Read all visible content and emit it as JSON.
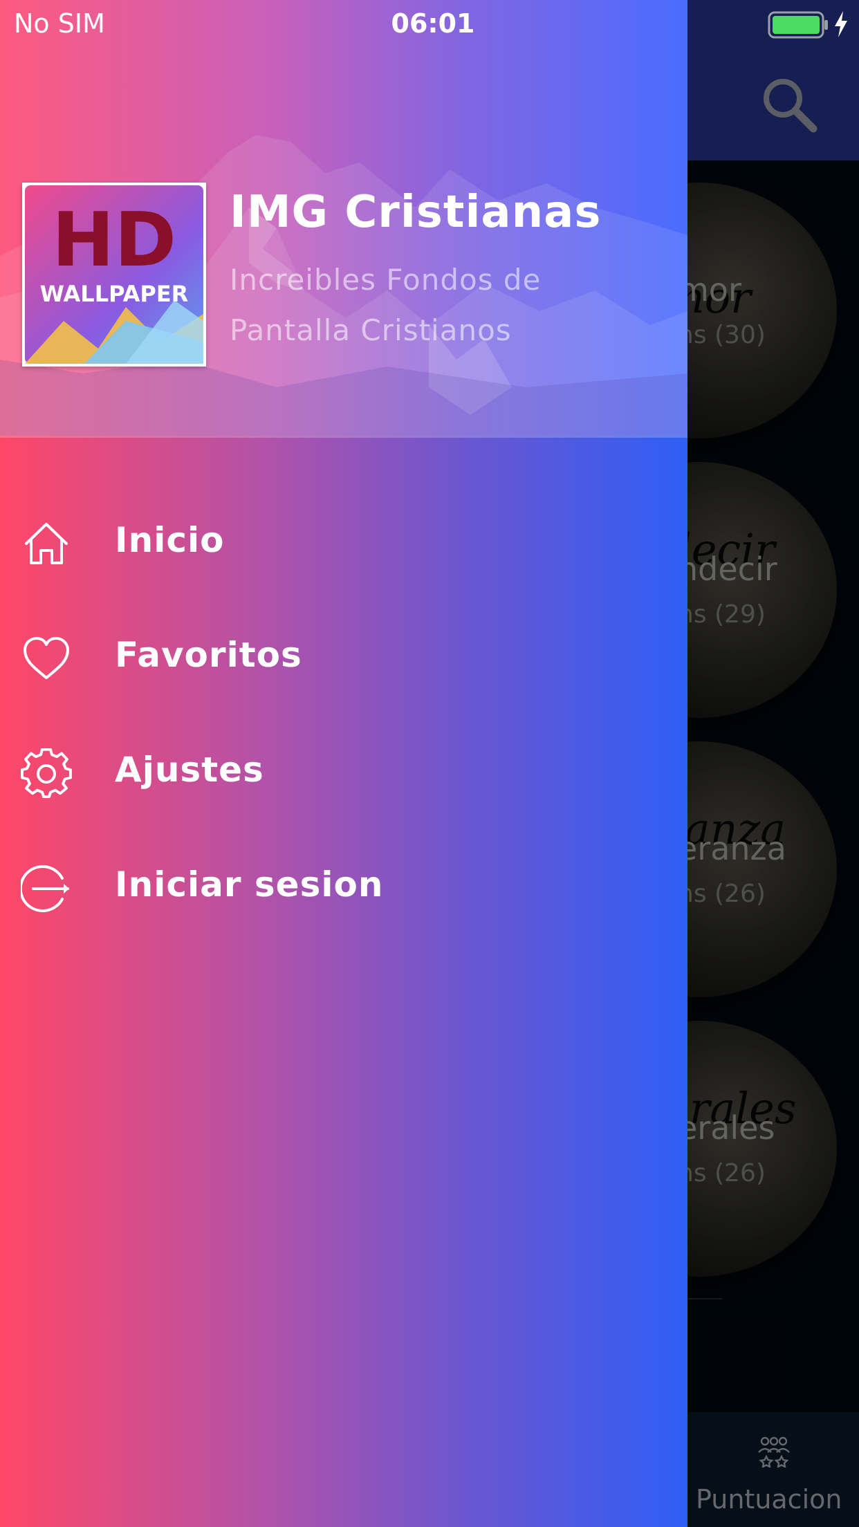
{
  "status_bar": {
    "carrier": "No SIM",
    "time": "06:01",
    "battery_icon": "battery-full-icon",
    "charging_icon": "lightning-bolt-icon"
  },
  "background_app": {
    "header": {
      "search_icon": "search-icon",
      "color": "#2b3a95"
    },
    "categories": [
      {
        "title_partial": "mor",
        "ghost_text": "mor",
        "count_partial": "ns (30)"
      },
      {
        "title_partial": "ndecir",
        "ghost_text": "decir",
        "count_partial": "ns (29)"
      },
      {
        "title_partial": "eranza",
        "ghost_text": "ranza",
        "count_partial": "ns (26)"
      },
      {
        "title_partial": "erales",
        "ghost_text": "erales",
        "count_partial": "ns (26)"
      }
    ],
    "bottom_nav": {
      "rating_label": "Puntuacion",
      "rating_icon": "group-rating-icon"
    }
  },
  "drawer": {
    "header": {
      "logo": {
        "line1": "HD",
        "line2": "WALLPAPER"
      },
      "title": "IMG Cristianas",
      "subtitle": "Increibles Fondos de Pantalla Cristianos"
    },
    "menu": [
      {
        "label": "Inicio",
        "icon": "home-icon"
      },
      {
        "label": "Favoritos",
        "icon": "heart-icon"
      },
      {
        "label": "Ajustes",
        "icon": "gear-icon"
      },
      {
        "label": "Iniciar sesion",
        "icon": "login-icon"
      }
    ],
    "colors": {
      "gradient_start": "#ff4767",
      "gradient_end": "#2f5ef6"
    }
  }
}
